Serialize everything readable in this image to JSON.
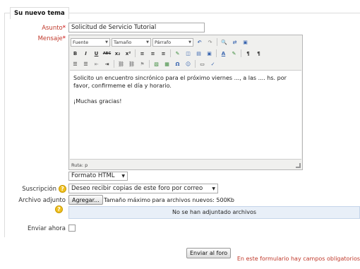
{
  "legend": "Su nuevo tema",
  "subject": {
    "label": "Asunto",
    "required_mark": "*",
    "value": "Solicitud de Servicio Tutorial"
  },
  "message": {
    "label": "Mensaje",
    "required_mark": "*",
    "toolbar": {
      "font": "Fuente",
      "size": "Tamaño",
      "format": "Párrafo",
      "row2": [
        "B",
        "I",
        "U",
        "ABC",
        "x₂",
        "x²",
        "≡",
        "≡",
        "≡",
        "✎",
        "◫",
        "▣",
        "▤",
        "A",
        "✎",
        "¶",
        "¶"
      ],
      "row3": [
        "☰",
        "☰",
        "⇤",
        "⇥",
        "⛓",
        "⛓",
        "⚑",
        "▧",
        "▦",
        "Ω",
        "✎",
        "▭",
        "♥"
      ]
    },
    "body_paragraphs": [
      "Solicito un encuentro sincrónico para el próximo viernes ..., a las .... hs. por favor, confirmeme el día y horario.",
      "¡Muchas gracias!"
    ],
    "path_label": "Ruta: p"
  },
  "format": {
    "value": "Formato HTML"
  },
  "subscription": {
    "label": "Suscripción",
    "value": "Deseo recibir copias de este foro por correo"
  },
  "attachment": {
    "label_line1": "Archivo adjunto",
    "button": "Agregar...",
    "max_size": "Tamaño máximo para archivos nuevos: 500Kb",
    "no_files": "No se han adjuntado archivos"
  },
  "send_now": {
    "label": "Enviar ahora"
  },
  "submit": "Enviar al foro",
  "required_note": "En este formulario hay campos obligatorios"
}
